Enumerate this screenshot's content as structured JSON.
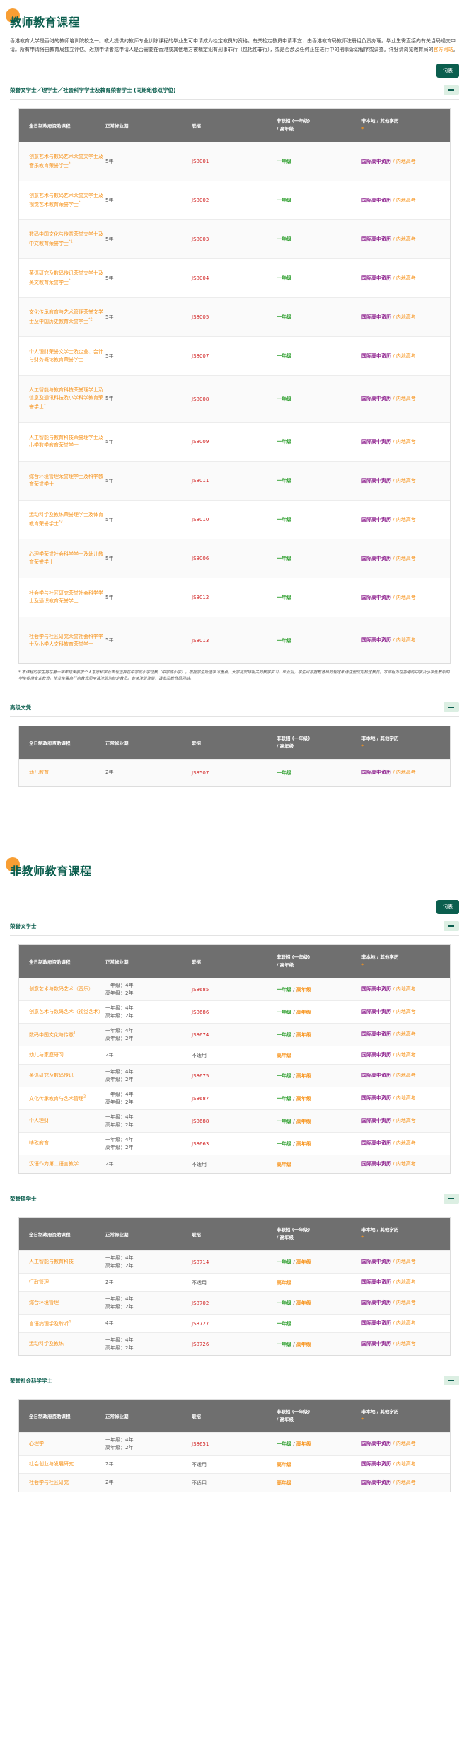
{
  "teacher": {
    "title": "教师教育课程",
    "intro_main": "香港教育大学是香港的教师培训院校之一。教大提供的教师专业训练课程的毕业生可申请成为检定教员的资格。有关检定教员申请事宜，由香港教育局教师注册组负责办理。毕业生需直接向有关当局递交申请。所有申请将由教育局独立评估。近期申请者或申请人是否需要在香港或其他地方被裁定犯有刑事罪行（包括性罪行），或是否涉及任何正在进行中的刑事诉讼程序或调查。详细请浏览教育局的",
    "intro_link": "官方网站",
    "intro_end": "。",
    "glossary": "词表",
    "groups": [
      {
        "title": "荣誉文学士／理学士／社会科学学士及教育荣誉学士 (同期组修双学位)",
        "rows": [
          {
            "name": "创意艺术与数码艺术荣誉文学士及音乐教育荣誉学士",
            "sup": "*",
            "mode": "5年",
            "jc": "JS8001",
            "nj": "一年级",
            "nj2": ""
          },
          {
            "name": "创意艺术与数码艺术荣誉文学士及视觉艺术教育荣誉学士",
            "sup": "*",
            "mode": "5年",
            "jc": "JS8002",
            "nj": "一年级",
            "nj2": ""
          },
          {
            "name": "数码中国文化与传意荣誉文学士及中文教育荣誉学士",
            "sup": "*1",
            "mode": "5年",
            "jc": "JS8003",
            "nj": "一年级",
            "nj2": ""
          },
          {
            "name": "英语研究及数码传讯荣誉文学士及英文教育荣誉学士",
            "sup": "*",
            "mode": "5年",
            "jc": "JS8004",
            "nj": "一年级",
            "nj2": ""
          },
          {
            "name": "文化传承教育与艺术管理荣誉文学士及中国历史教育荣誉学士",
            "sup": "*2",
            "mode": "5年",
            "jc": "JS8005",
            "nj": "一年级",
            "nj2": ""
          },
          {
            "name": "个人理财荣誉文学士及企业、会计与财务概论教育荣誉学士",
            "sup": "",
            "mode": "5年",
            "jc": "JS8007",
            "nj": "一年级",
            "nj2": ""
          },
          {
            "name": "人工智能与教育科技荣誉理学士及信息及通讯科技及小学科学教育荣誉学士",
            "sup": "*",
            "mode": "5年",
            "jc": "JS8008",
            "nj": "一年级",
            "nj2": ""
          },
          {
            "name": "人工智能与教育科技荣誉理学士及小学数学教育荣誉学士",
            "sup": "",
            "mode": "5年",
            "jc": "JS8009",
            "nj": "一年级",
            "nj2": ""
          },
          {
            "name": "综合环境管理荣誉理学士及科学教育荣誉学士",
            "sup": "",
            "mode": "5年",
            "jc": "JS8011",
            "nj": "一年级",
            "nj2": ""
          },
          {
            "name": "运动科学及教练荣誉理学士及体育教育荣誉学士",
            "sup": "*3",
            "mode": "5年",
            "jc": "JS8010",
            "nj": "一年级",
            "nj2": ""
          },
          {
            "name": "心理学荣誉社会科学学士及幼儿教育荣誉学士",
            "sup": "",
            "mode": "5年",
            "jc": "JS8006",
            "nj": "一年级",
            "nj2": ""
          },
          {
            "name": "社会学与社区研究荣誉社会科学学士及通识教育荣誉学士",
            "sup": "",
            "mode": "5年",
            "jc": "JS8012",
            "nj": "一年级",
            "nj2": ""
          },
          {
            "name": "社会学与社区研究荣誉社会科学学士及小学人文科教育荣誉学士",
            "sup": "",
            "mode": "5年",
            "jc": "JS8013",
            "nj": "一年级",
            "nj2": ""
          }
        ],
        "note": "* 本课程的学生将在第一学年结束前按个人意愿和学业表现选择在中学或小学任教（中学或小学）。根据学生所选学习重点，大学将安排相关的教学实习。毕业后，学生可根据教育局的规定申请注册成为检定教员。本课程为在香港的中学及小学任教职的学生提供专业教育。毕业生需自行向教育局申请注册为检定教员。有关注册详情，请参阅教育局网站。"
      },
      {
        "title": "高级文凭",
        "rows": [
          {
            "name": "幼儿教育",
            "sup": "",
            "mode": "2年",
            "jc": "JS8507",
            "nj": "一年级",
            "nj2": ""
          }
        ],
        "note": ""
      }
    ]
  },
  "nonteacher": {
    "title": "非教师教育课程",
    "glossary": "词表",
    "groups": [
      {
        "title": "荣誉文学士",
        "rows": [
          {
            "name": "创意艺术与数码艺术（音乐）",
            "sup": "",
            "mode": "一年级：4年|高年级：2年",
            "jc": "JS8685",
            "nj": "一年级",
            "nj2": "高年级"
          },
          {
            "name": "创意艺术与数码艺术（视觉艺术）",
            "sup": "",
            "mode": "一年级：4年|高年级：2年",
            "jc": "JS8686",
            "nj": "一年级",
            "nj2": "高年级"
          },
          {
            "name": "数码中国文化与传意",
            "sup": "1",
            "mode": "一年级：4年|高年级：2年",
            "jc": "JS8674",
            "nj": "一年级",
            "nj2": "高年级"
          },
          {
            "name": "幼儿与家庭研习",
            "sup": "",
            "mode": "2年",
            "jc": "不适用",
            "nj": "",
            "nj2": "高年级"
          },
          {
            "name": "英语研究及数码传讯",
            "sup": "",
            "mode": "一年级：4年|高年级：2年",
            "jc": "JS8675",
            "nj": "一年级",
            "nj2": "高年级"
          },
          {
            "name": "文化传承教育与艺术管理",
            "sup": "2",
            "mode": "一年级：4年|高年级：2年",
            "jc": "JS8687",
            "nj": "一年级",
            "nj2": "高年级"
          },
          {
            "name": "个人理财",
            "sup": "",
            "mode": "一年级：4年|高年级：2年",
            "jc": "JS8688",
            "nj": "一年级",
            "nj2": "高年级"
          },
          {
            "name": "特殊教育",
            "sup": "",
            "mode": "一年级：4年|高年级：2年",
            "jc": "JS8663",
            "nj": "一年级",
            "nj2": "高年级"
          },
          {
            "name": "汉语作为第二语言教学",
            "sup": "",
            "mode": "2年",
            "jc": "不适用",
            "nj": "",
            "nj2": "高年级"
          }
        ]
      },
      {
        "title": "荣誉理学士",
        "rows": [
          {
            "name": "人工智能与教育科技",
            "sup": "",
            "mode": "一年级：4年|高年级：2年",
            "jc": "JS8714",
            "nj": "一年级",
            "nj2": "高年级"
          },
          {
            "name": "行政管理",
            "sup": "",
            "mode": "2年",
            "jc": "不适用",
            "nj": "",
            "nj2": "高年级"
          },
          {
            "name": "综合环境管理",
            "sup": "",
            "mode": "一年级：4年|高年级：2年",
            "jc": "JS8702",
            "nj": "一年级",
            "nj2": "高年级"
          },
          {
            "name": "言语病理学及聆听",
            "sup": "4",
            "mode": "4年",
            "jc": "JS8727",
            "nj": "一年级",
            "nj2": ""
          },
          {
            "name": "运动科学及教练",
            "sup": "",
            "mode": "一年级：4年|高年级：2年",
            "jc": "JS8726",
            "nj": "一年级",
            "nj2": "高年级"
          }
        ]
      },
      {
        "title": "荣誉社会科学学士",
        "rows": [
          {
            "name": "心理学",
            "sup": "",
            "mode": "一年级：4年|高年级：2年",
            "jc": "JS8651",
            "nj": "一年级",
            "nj2": "高年级"
          },
          {
            "name": "社会创业与发展研究",
            "sup": "",
            "mode": "2年",
            "jc": "不适用",
            "nj": "",
            "nj2": "高年级"
          },
          {
            "name": "社会学与社区研究",
            "sup": "",
            "mode": "2年",
            "jc": "不适用",
            "nj": "",
            "nj2": "高年级"
          }
        ]
      }
    ]
  },
  "table_headers": {
    "program": "全日制政府资助课程",
    "mode": "正常修业期",
    "jupas": "联招",
    "nonjupas_a": "非联招 (一年级)",
    "nonjupas_b": "/ 高年级",
    "nl_a": "非本地 / 其他学历",
    "nl_b": "*"
  },
  "nonlocal_label": {
    "primary": "国际高中资历",
    "sep": " / ",
    "secondary": "内地高考"
  }
}
